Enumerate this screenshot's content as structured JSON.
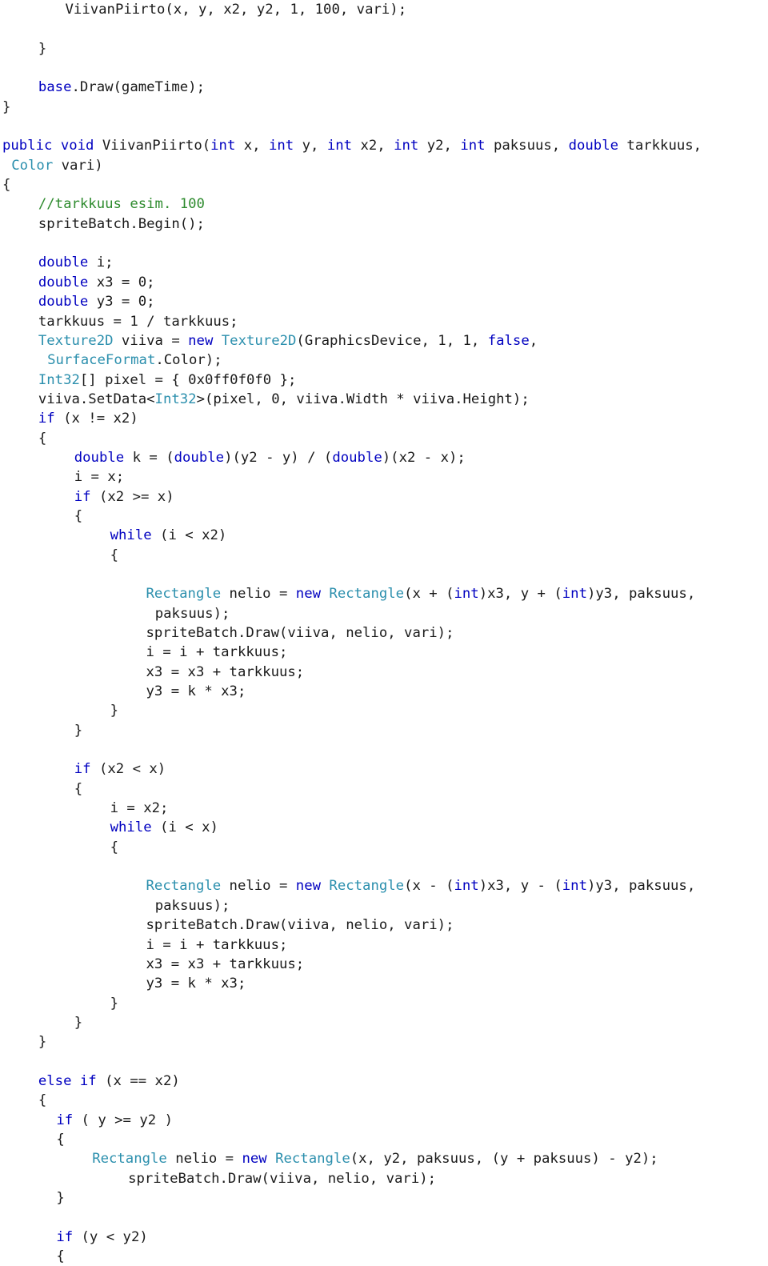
{
  "document": {
    "kind": "source-code-listing",
    "language": "C#",
    "colors": {
      "background": "#ffffff",
      "plain": "#1a1a1a",
      "keyword": "#0000c0",
      "type": "#2b8fad",
      "comment": "#2e8b2e"
    }
  },
  "code": {
    "lines": [
      {
        "indent": 7,
        "tokens": [
          {
            "t": "pln",
            "s": "ViivanPiirto(x, y, x2, y2, 1, 100, vari);"
          }
        ]
      },
      {
        "indent": 0,
        "tokens": [
          {
            "t": "pln",
            "s": ""
          }
        ]
      },
      {
        "indent": 4,
        "tokens": [
          {
            "t": "pln",
            "s": "}"
          }
        ]
      },
      {
        "indent": 0,
        "tokens": [
          {
            "t": "pln",
            "s": ""
          }
        ]
      },
      {
        "indent": 4,
        "tokens": [
          {
            "t": "kw",
            "s": "base"
          },
          {
            "t": "pln",
            "s": ".Draw(gameTime);"
          }
        ]
      },
      {
        "indent": 0,
        "tokens": [
          {
            "t": "pln",
            "s": "}"
          }
        ]
      },
      {
        "indent": 0,
        "tokens": [
          {
            "t": "pln",
            "s": ""
          }
        ]
      },
      {
        "indent": 0,
        "tokens": [
          {
            "t": "kw",
            "s": "public"
          },
          {
            "t": "pln",
            "s": " "
          },
          {
            "t": "kw",
            "s": "void"
          },
          {
            "t": "pln",
            "s": " ViivanPiirto("
          },
          {
            "t": "kw",
            "s": "int"
          },
          {
            "t": "pln",
            "s": " x, "
          },
          {
            "t": "kw",
            "s": "int"
          },
          {
            "t": "pln",
            "s": " y, "
          },
          {
            "t": "kw",
            "s": "int"
          },
          {
            "t": "pln",
            "s": " x2, "
          },
          {
            "t": "kw",
            "s": "int"
          },
          {
            "t": "pln",
            "s": " y2, "
          },
          {
            "t": "kw",
            "s": "int"
          },
          {
            "t": "pln",
            "s": " paksuus, "
          },
          {
            "t": "kw",
            "s": "double"
          },
          {
            "t": "pln",
            "s": " tarkkuus,"
          }
        ]
      },
      {
        "indent": 1,
        "tokens": [
          {
            "t": "typ",
            "s": "Color"
          },
          {
            "t": "pln",
            "s": " vari)"
          }
        ]
      },
      {
        "indent": 0,
        "tokens": [
          {
            "t": "pln",
            "s": "{"
          }
        ]
      },
      {
        "indent": 4,
        "tokens": [
          {
            "t": "cmt",
            "s": "//tarkkuus esim. 100"
          }
        ]
      },
      {
        "indent": 4,
        "tokens": [
          {
            "t": "pln",
            "s": "spriteBatch.Begin();"
          }
        ]
      },
      {
        "indent": 0,
        "tokens": [
          {
            "t": "pln",
            "s": ""
          }
        ]
      },
      {
        "indent": 4,
        "tokens": [
          {
            "t": "kw",
            "s": "double"
          },
          {
            "t": "pln",
            "s": " i;"
          }
        ]
      },
      {
        "indent": 4,
        "tokens": [
          {
            "t": "kw",
            "s": "double"
          },
          {
            "t": "pln",
            "s": " x3 = 0;"
          }
        ]
      },
      {
        "indent": 4,
        "tokens": [
          {
            "t": "kw",
            "s": "double"
          },
          {
            "t": "pln",
            "s": " y3 = 0;"
          }
        ]
      },
      {
        "indent": 4,
        "tokens": [
          {
            "t": "pln",
            "s": "tarkkuus = 1 / tarkkuus;"
          }
        ]
      },
      {
        "indent": 4,
        "tokens": [
          {
            "t": "typ",
            "s": "Texture2D"
          },
          {
            "t": "pln",
            "s": " viiva = "
          },
          {
            "t": "kw",
            "s": "new"
          },
          {
            "t": "pln",
            "s": " "
          },
          {
            "t": "typ",
            "s": "Texture2D"
          },
          {
            "t": "pln",
            "s": "(GraphicsDevice, 1, 1, "
          },
          {
            "t": "kw",
            "s": "false"
          },
          {
            "t": "pln",
            "s": ","
          }
        ]
      },
      {
        "indent": 5,
        "tokens": [
          {
            "t": "typ",
            "s": "SurfaceFormat"
          },
          {
            "t": "pln",
            "s": ".Color);"
          }
        ]
      },
      {
        "indent": 4,
        "tokens": [
          {
            "t": "typ",
            "s": "Int32"
          },
          {
            "t": "pln",
            "s": "[] pixel = { 0x0ff0f0f0 };"
          }
        ]
      },
      {
        "indent": 4,
        "tokens": [
          {
            "t": "pln",
            "s": "viiva.SetData<"
          },
          {
            "t": "typ",
            "s": "Int32"
          },
          {
            "t": "pln",
            "s": ">(pixel, 0, viiva.Width * viiva.Height);"
          }
        ]
      },
      {
        "indent": 4,
        "tokens": [
          {
            "t": "kw",
            "s": "if"
          },
          {
            "t": "pln",
            "s": " (x != x2)"
          }
        ]
      },
      {
        "indent": 4,
        "tokens": [
          {
            "t": "pln",
            "s": "{"
          }
        ]
      },
      {
        "indent": 8,
        "tokens": [
          {
            "t": "kw",
            "s": "double"
          },
          {
            "t": "pln",
            "s": " k = ("
          },
          {
            "t": "kw",
            "s": "double"
          },
          {
            "t": "pln",
            "s": ")(y2 - y) / ("
          },
          {
            "t": "kw",
            "s": "double"
          },
          {
            "t": "pln",
            "s": ")(x2 - x);"
          }
        ]
      },
      {
        "indent": 8,
        "tokens": [
          {
            "t": "pln",
            "s": "i = x;"
          }
        ]
      },
      {
        "indent": 8,
        "tokens": [
          {
            "t": "kw",
            "s": "if"
          },
          {
            "t": "pln",
            "s": " (x2 >= x)"
          }
        ]
      },
      {
        "indent": 8,
        "tokens": [
          {
            "t": "pln",
            "s": "{"
          }
        ]
      },
      {
        "indent": 12,
        "tokens": [
          {
            "t": "kw",
            "s": "while"
          },
          {
            "t": "pln",
            "s": " (i < x2)"
          }
        ]
      },
      {
        "indent": 12,
        "tokens": [
          {
            "t": "pln",
            "s": "{"
          }
        ]
      },
      {
        "indent": 0,
        "tokens": [
          {
            "t": "pln",
            "s": ""
          }
        ]
      },
      {
        "indent": 16,
        "tokens": [
          {
            "t": "typ",
            "s": "Rectangle"
          },
          {
            "t": "pln",
            "s": " nelio = "
          },
          {
            "t": "kw",
            "s": "new"
          },
          {
            "t": "pln",
            "s": " "
          },
          {
            "t": "typ",
            "s": "Rectangle"
          },
          {
            "t": "pln",
            "s": "(x + ("
          },
          {
            "t": "kw",
            "s": "int"
          },
          {
            "t": "pln",
            "s": ")x3, y + ("
          },
          {
            "t": "kw",
            "s": "int"
          },
          {
            "t": "pln",
            "s": ")y3, paksuus,"
          }
        ]
      },
      {
        "indent": 17,
        "tokens": [
          {
            "t": "pln",
            "s": "paksuus);"
          }
        ]
      },
      {
        "indent": 16,
        "tokens": [
          {
            "t": "pln",
            "s": "spriteBatch.Draw(viiva, nelio, vari);"
          }
        ]
      },
      {
        "indent": 16,
        "tokens": [
          {
            "t": "pln",
            "s": "i = i + tarkkuus;"
          }
        ]
      },
      {
        "indent": 16,
        "tokens": [
          {
            "t": "pln",
            "s": "x3 = x3 + tarkkuus;"
          }
        ]
      },
      {
        "indent": 16,
        "tokens": [
          {
            "t": "pln",
            "s": "y3 = k * x3;"
          }
        ]
      },
      {
        "indent": 12,
        "tokens": [
          {
            "t": "pln",
            "s": "}"
          }
        ]
      },
      {
        "indent": 8,
        "tokens": [
          {
            "t": "pln",
            "s": "}"
          }
        ]
      },
      {
        "indent": 0,
        "tokens": [
          {
            "t": "pln",
            "s": ""
          }
        ]
      },
      {
        "indent": 8,
        "tokens": [
          {
            "t": "kw",
            "s": "if"
          },
          {
            "t": "pln",
            "s": " (x2 < x)"
          }
        ]
      },
      {
        "indent": 8,
        "tokens": [
          {
            "t": "pln",
            "s": "{"
          }
        ]
      },
      {
        "indent": 12,
        "tokens": [
          {
            "t": "pln",
            "s": "i = x2;"
          }
        ]
      },
      {
        "indent": 12,
        "tokens": [
          {
            "t": "kw",
            "s": "while"
          },
          {
            "t": "pln",
            "s": " (i < x)"
          }
        ]
      },
      {
        "indent": 12,
        "tokens": [
          {
            "t": "pln",
            "s": "{"
          }
        ]
      },
      {
        "indent": 0,
        "tokens": [
          {
            "t": "pln",
            "s": ""
          }
        ]
      },
      {
        "indent": 16,
        "tokens": [
          {
            "t": "typ",
            "s": "Rectangle"
          },
          {
            "t": "pln",
            "s": " nelio = "
          },
          {
            "t": "kw",
            "s": "new"
          },
          {
            "t": "pln",
            "s": " "
          },
          {
            "t": "typ",
            "s": "Rectangle"
          },
          {
            "t": "pln",
            "s": "(x - ("
          },
          {
            "t": "kw",
            "s": "int"
          },
          {
            "t": "pln",
            "s": ")x3, y - ("
          },
          {
            "t": "kw",
            "s": "int"
          },
          {
            "t": "pln",
            "s": ")y3, paksuus,"
          }
        ]
      },
      {
        "indent": 17,
        "tokens": [
          {
            "t": "pln",
            "s": "paksuus);"
          }
        ]
      },
      {
        "indent": 16,
        "tokens": [
          {
            "t": "pln",
            "s": "spriteBatch.Draw(viiva, nelio, vari);"
          }
        ]
      },
      {
        "indent": 16,
        "tokens": [
          {
            "t": "pln",
            "s": "i = i + tarkkuus;"
          }
        ]
      },
      {
        "indent": 16,
        "tokens": [
          {
            "t": "pln",
            "s": "x3 = x3 + tarkkuus;"
          }
        ]
      },
      {
        "indent": 16,
        "tokens": [
          {
            "t": "pln",
            "s": "y3 = k * x3;"
          }
        ]
      },
      {
        "indent": 12,
        "tokens": [
          {
            "t": "pln",
            "s": "}"
          }
        ]
      },
      {
        "indent": 8,
        "tokens": [
          {
            "t": "pln",
            "s": "}"
          }
        ]
      },
      {
        "indent": 4,
        "tokens": [
          {
            "t": "pln",
            "s": "}"
          }
        ]
      },
      {
        "indent": 0,
        "tokens": [
          {
            "t": "pln",
            "s": ""
          }
        ]
      },
      {
        "indent": 4,
        "tokens": [
          {
            "t": "kw",
            "s": "else"
          },
          {
            "t": "pln",
            "s": " "
          },
          {
            "t": "kw",
            "s": "if"
          },
          {
            "t": "pln",
            "s": " (x == x2)"
          }
        ]
      },
      {
        "indent": 4,
        "tokens": [
          {
            "t": "pln",
            "s": "{"
          }
        ]
      },
      {
        "indent": 6,
        "tokens": [
          {
            "t": "kw",
            "s": "if"
          },
          {
            "t": "pln",
            "s": " ( y >= y2 )"
          }
        ]
      },
      {
        "indent": 6,
        "tokens": [
          {
            "t": "pln",
            "s": "{"
          }
        ]
      },
      {
        "indent": 10,
        "tokens": [
          {
            "t": "typ",
            "s": "Rectangle"
          },
          {
            "t": "pln",
            "s": " nelio = "
          },
          {
            "t": "kw",
            "s": "new"
          },
          {
            "t": "pln",
            "s": " "
          },
          {
            "t": "typ",
            "s": "Rectangle"
          },
          {
            "t": "pln",
            "s": "(x, y2, paksuus, (y + paksuus) - y2);"
          }
        ]
      },
      {
        "indent": 14,
        "tokens": [
          {
            "t": "pln",
            "s": "spriteBatch.Draw(viiva, nelio, vari);"
          }
        ]
      },
      {
        "indent": 6,
        "tokens": [
          {
            "t": "pln",
            "s": "}"
          }
        ]
      },
      {
        "indent": 0,
        "tokens": [
          {
            "t": "pln",
            "s": ""
          }
        ]
      },
      {
        "indent": 6,
        "tokens": [
          {
            "t": "kw",
            "s": "if"
          },
          {
            "t": "pln",
            "s": " (y < y2)"
          }
        ]
      },
      {
        "indent": 6,
        "tokens": [
          {
            "t": "pln",
            "s": "{"
          }
        ]
      }
    ]
  }
}
